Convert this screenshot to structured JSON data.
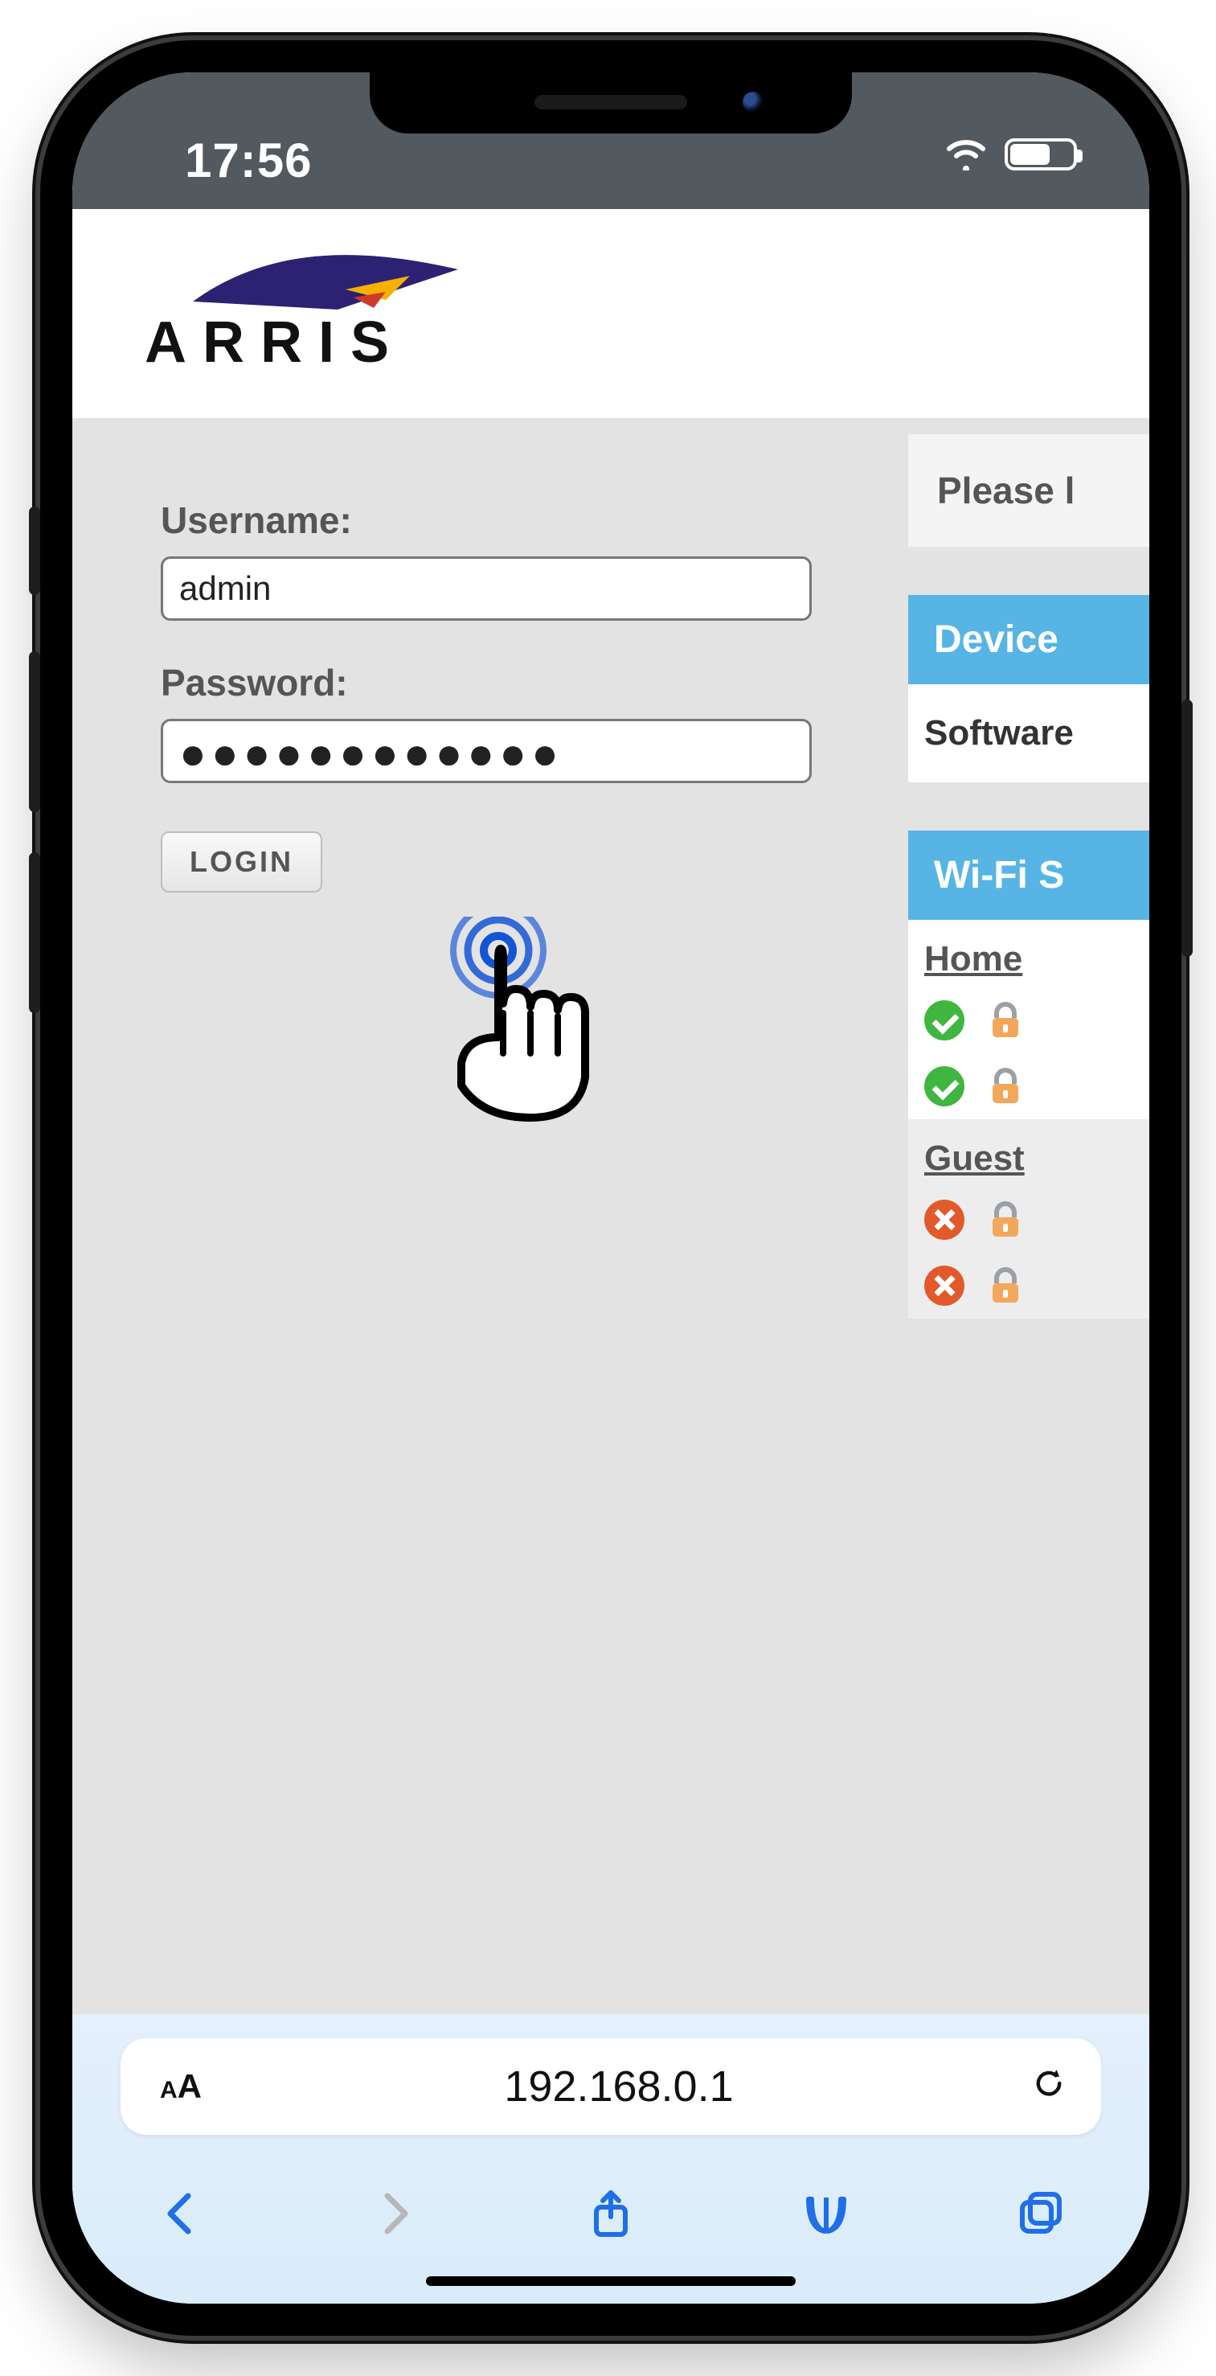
{
  "status": {
    "time": "17:56"
  },
  "brand": "ARRIS",
  "login": {
    "username_label": "Username:",
    "username_value": "admin",
    "password_label": "Password:",
    "password_value": "●●●●●●●●●●●●",
    "login_label": "LOGIN"
  },
  "side": {
    "please": "Please l",
    "device_head": "Device",
    "software_row": "Software",
    "wifi_head": "Wi-Fi S",
    "home_title": "Home",
    "guest_title": "Guest"
  },
  "addr": {
    "url": "192.168.0.1"
  }
}
